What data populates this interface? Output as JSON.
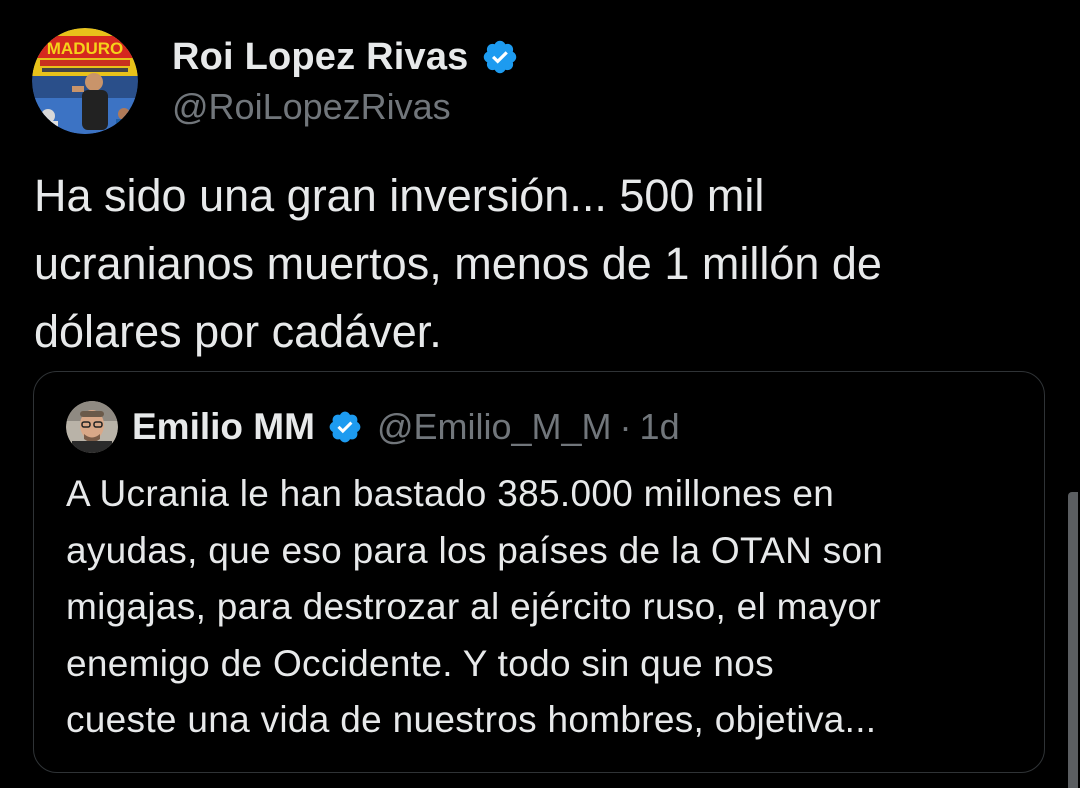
{
  "tweet": {
    "author": {
      "display_name": "Roi Lopez Rivas",
      "handle": "@RoiLopezRivas",
      "verified_icon": "verified-badge-icon",
      "avatar_sign_text": "MADURO"
    },
    "text": "Ha sido una gran inversión... 500 mil\nucranianos muertos, menos de 1 millón de\ndólares por cadáver."
  },
  "quoted_tweet": {
    "author": {
      "display_name": "Emilio MM",
      "handle": "@Emilio_M_M",
      "verified_icon": "verified-badge-icon"
    },
    "separator": "·",
    "timestamp": "1d",
    "text": "A Ucrania le han bastado 385.000 millones en\nayudas, que eso para los países de la OTAN son\nmigajas, para destrozar al ejército ruso, el mayor\nenemigo de Occidente. Y todo sin que nos\ncueste una vida de nuestros hombres, objetiva..."
  },
  "colors": {
    "background": "#000000",
    "text_primary": "#e7e9ea",
    "text_secondary": "#71767b",
    "verified_blue": "#1d9bf0",
    "border": "#2f3336"
  }
}
